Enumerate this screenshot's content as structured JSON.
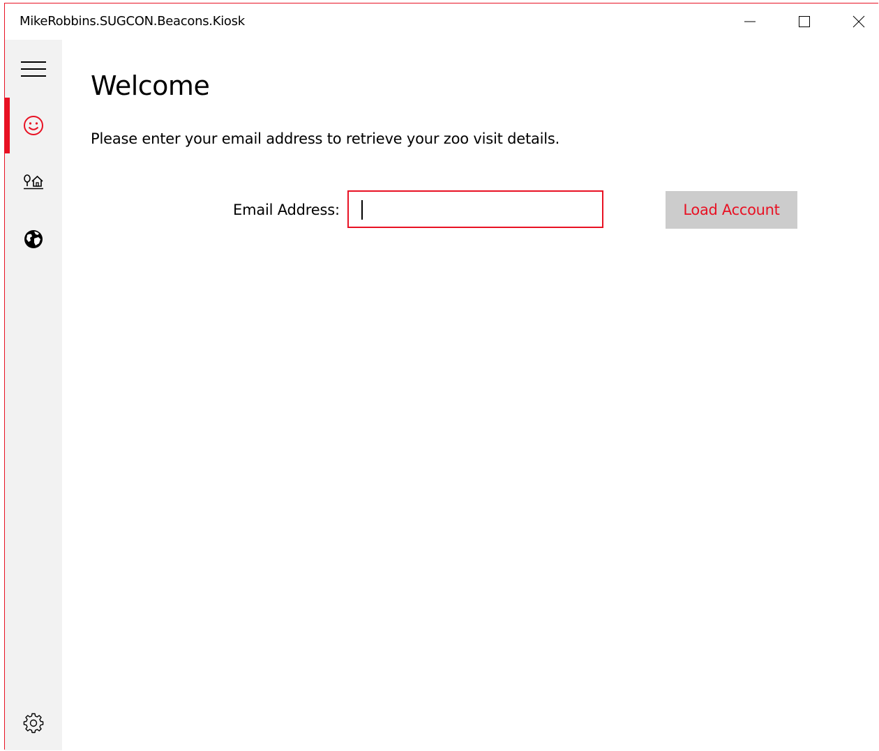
{
  "window": {
    "title": "MikeRobbins.SUGCON.Beacons.Kiosk",
    "accent_color": "#e81123"
  },
  "caption_buttons": {
    "minimize_icon": "minimize-icon",
    "maximize_icon": "maximize-icon",
    "close_icon": "close-icon"
  },
  "nav": {
    "items": [
      {
        "id": "menu",
        "icon": "hamburger-icon"
      },
      {
        "id": "welcome",
        "icon": "smiley-icon",
        "selected": true
      },
      {
        "id": "zoo",
        "icon": "tree-house-icon"
      },
      {
        "id": "world",
        "icon": "globe-icon"
      },
      {
        "id": "settings",
        "icon": "gear-icon"
      }
    ]
  },
  "main": {
    "title": "Welcome",
    "instruction": "Please enter your email address to retrieve your zoo visit details.",
    "email_label": "Email Address:",
    "email_value": "",
    "load_button": "Load Account"
  }
}
